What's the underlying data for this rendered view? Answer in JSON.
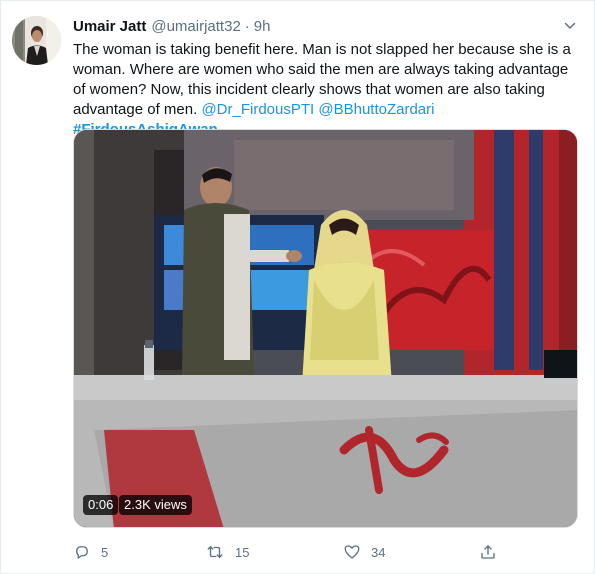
{
  "tweet": {
    "author_name": "Umair Jatt",
    "handle": "@umairjatt32",
    "separator": "·",
    "time": "9h",
    "text_main": "The woman is taking benefit here. Man is not slapped her because she is a woman. Where are women who said the men are always taking advantage of women? Now, this incident clearly shows that women are also taking advantage of men.",
    "mention_1": "@Dr_FirdousPTI",
    "mention_2": "@BBhuttoZardari",
    "hashtag": "#FirdousAshiqAwan"
  },
  "video": {
    "duration": "0:06",
    "views": "2.3K views"
  },
  "actions": {
    "reply_count": "5",
    "retweet_count": "15",
    "like_count": "34"
  },
  "colors": {
    "link": "#1b95e0",
    "muted": "#5b7083",
    "text": "#0f1419"
  },
  "icons": [
    "avatar",
    "more-icon",
    "reply-icon",
    "retweet-icon",
    "like-icon",
    "share-icon"
  ]
}
